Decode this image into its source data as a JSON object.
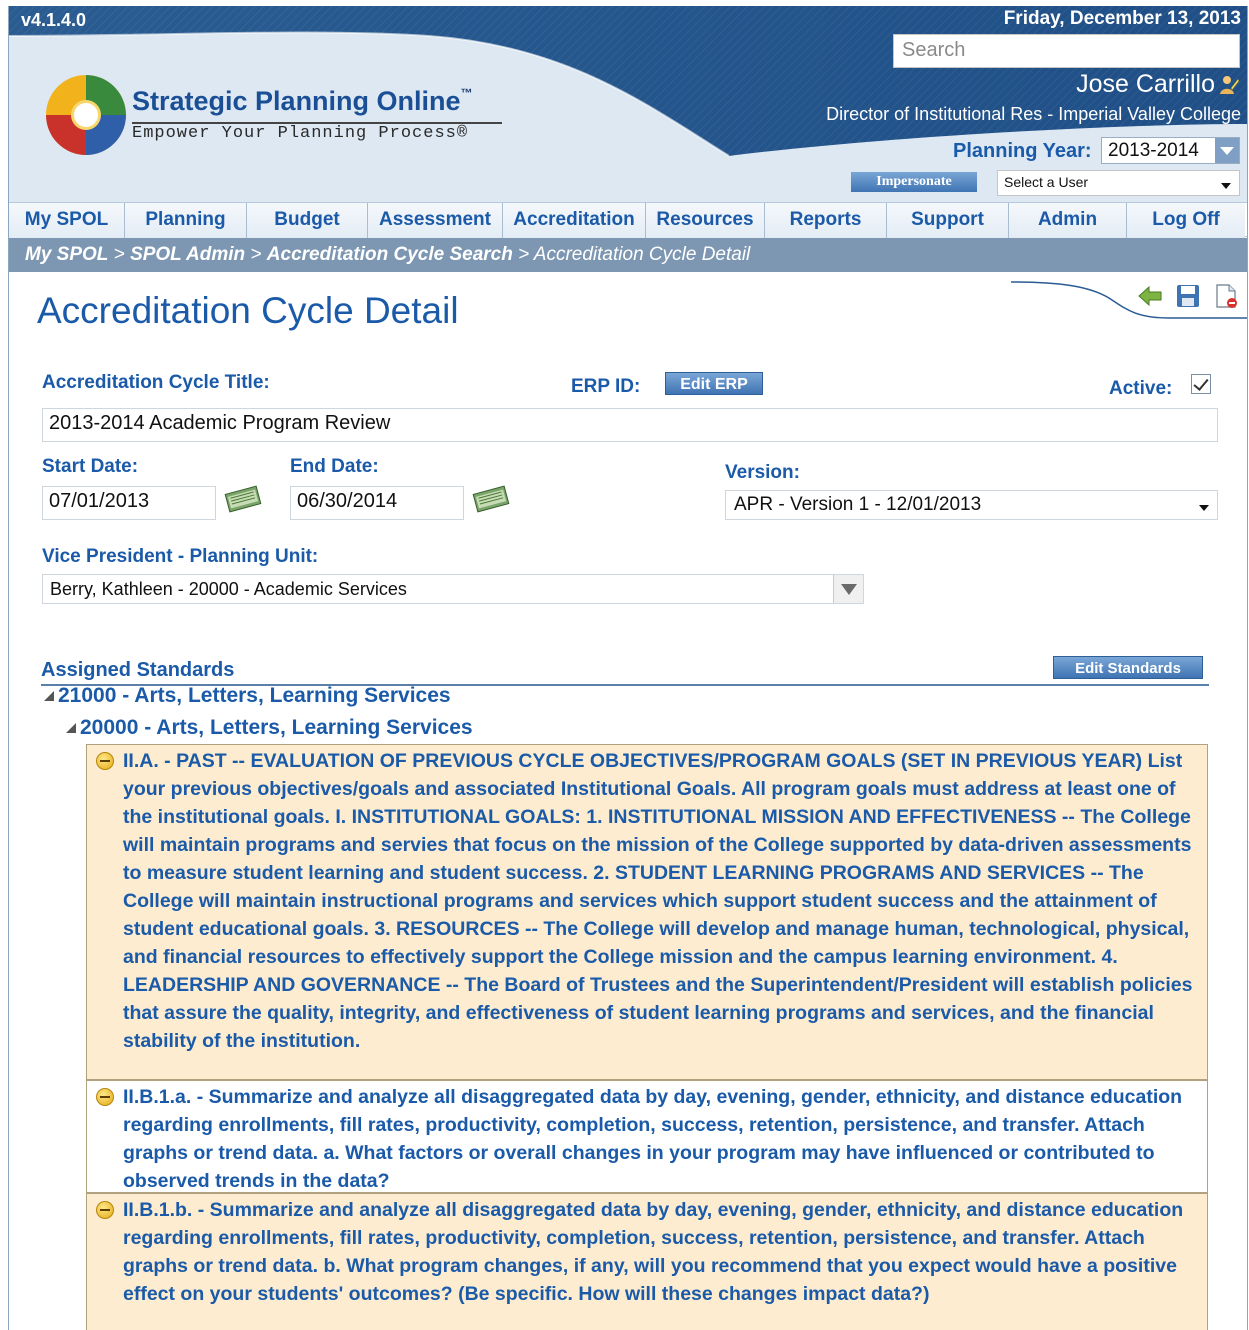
{
  "header": {
    "version": "v4.1.4.0",
    "date": "Friday, December 13, 2013",
    "search_placeholder": "Search",
    "user_name": "Jose Carrillo",
    "user_title": "Director of Institutional Res - Imperial Valley College",
    "planning_year_label": "Planning Year:",
    "planning_year_value": "2013-2014",
    "impersonate_label": "Impersonate",
    "select_user_value": "Select a User",
    "logo_title": "Strategic Planning Online",
    "logo_tm": "™",
    "logo_sub": "Empower Your Planning Process®"
  },
  "nav": {
    "items": [
      "My SPOL",
      "Planning",
      "Budget",
      "Assessment",
      "Accreditation",
      "Resources",
      "Reports",
      "Support",
      "Admin",
      "Log Off"
    ]
  },
  "breadcrumb": {
    "items": [
      "My SPOL",
      "SPOL Admin",
      "Accreditation Cycle Search"
    ],
    "current": "Accreditation Cycle Detail",
    "sep": " > "
  },
  "page": {
    "title": "Accreditation Cycle Detail"
  },
  "form": {
    "cycle_title_label": "Accreditation Cycle Title:",
    "erp_id_label": "ERP ID:",
    "edit_erp_label": "Edit ERP",
    "active_label": "Active:",
    "cycle_title_value": "2013-2014 Academic Program Review",
    "start_date_label": "Start Date:",
    "start_date_value": "07/01/2013",
    "end_date_label": "End Date:",
    "end_date_value": "06/30/2014",
    "version_label": "Version:",
    "version_value": "APR - Version 1 - 12/01/2013",
    "vp_label": "Vice President - Planning Unit:",
    "vp_value": "Berry, Kathleen - 20000 - Academic Services"
  },
  "standards": {
    "header": "Assigned Standards",
    "edit_label": "Edit Standards",
    "tree_level1": "21000 - Arts, Letters, Learning Services",
    "tree_level2": "20000 - Arts, Letters, Learning Services",
    "items": [
      "II.A. - PAST -- EVALUATION OF PREVIOUS CYCLE OBJECTIVES/PROGRAM GOALS (SET IN PREVIOUS YEAR) List your previous objectives/goals and associated Institutional Goals. All program goals must address at least one of the institutional goals. I. INSTITUTIONAL GOALS: 1. INSTITUTIONAL MISSION AND EFFECTIVENESS -- The College will maintain programs and servies that focus on the mission of the College supported by data-driven assessments to measure student learning and student success. 2. STUDENT LEARNING PROGRAMS AND SERVICES -- The College will maintain instructional programs and services which support student success and the attainment of student educational goals. 3. RESOURCES -- The College will develop and manage human, technological, physical, and financial resources to effectively support the College mission and the campus learning environment. 4. LEADERSHIP AND GOVERNANCE -- The Board of Trustees and the Superintendent/President will establish policies that assure the quality, integrity, and effectiveness of student learning programs and services, and the financial stability of the institution.",
      "II.B.1.a. - Summarize and analyze all disaggregated data by day, evening, gender, ethnicity, and distance education regarding enrollments, fill rates, productivity, completion, success, retention, persistence, and transfer. Attach graphs or trend data. a. What factors or overall changes in your program may have influenced or contributed to observed trends in the data?",
      "II.B.1.b. - Summarize and analyze all disaggregated data by day, evening, gender, ethnicity, and distance education regarding enrollments, fill rates, productivity, completion, success, retention, persistence, and transfer. Attach graphs or trend data. b. What program changes, if any, will you recommend that you expect would have a positive effect on your students' outcomes? (Be specific. How will these changes impact data?)"
    ]
  },
  "colors": {
    "brand_blue": "#1a5aa8",
    "header_dark": "#1f4f86",
    "crumb_bg": "#7d97b2",
    "row_alt": "#fdecd0"
  }
}
